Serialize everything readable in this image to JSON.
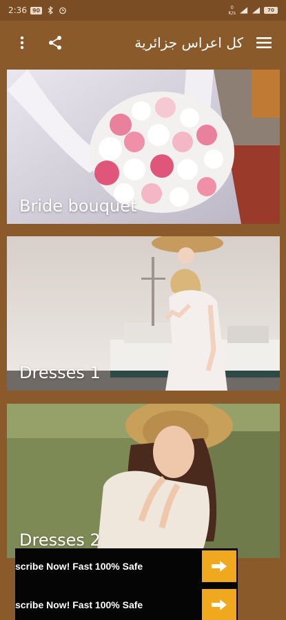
{
  "status_bar": {
    "time": "2:36",
    "badge": "90",
    "net_speed_value": "0",
    "net_speed_unit": "K/s",
    "battery": "70"
  },
  "app_bar": {
    "title": "كل اعراس جزائرية"
  },
  "cards": [
    {
      "label": "Bride bouquet"
    },
    {
      "label": "Dresses 1"
    },
    {
      "label": "Dresses 2"
    }
  ],
  "ad": {
    "line1": "scribe Now! Fast 100% Safe",
    "line2": "scribe Now! Fast 100% Safe"
  },
  "colors": {
    "background": "#8b5a2b",
    "ad_accent": "#f0a81e"
  }
}
